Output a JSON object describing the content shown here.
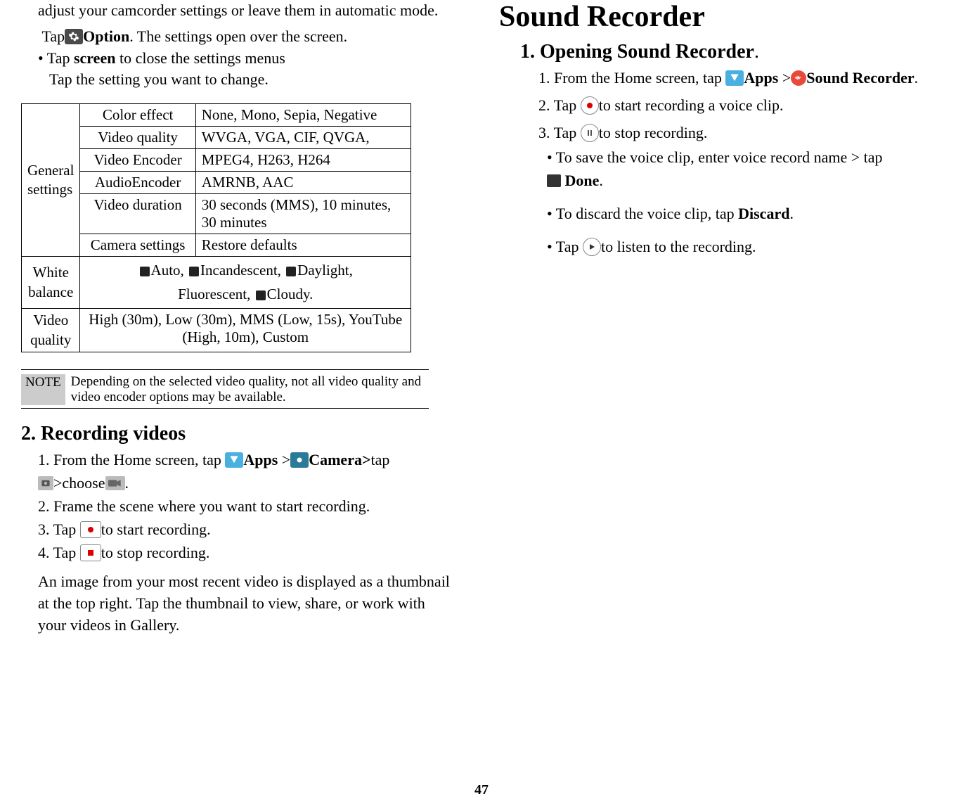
{
  "left": {
    "intro1": "adjust your camcorder settings or leave them in automatic mode.",
    "tap_label": "Tap",
    "option_bold": "Option",
    "tap_rest": ". The settings open over the screen.",
    "bullet1_a": "• Tap ",
    "bullet1_bold": "screen",
    "bullet1_b": " to close the settings menus",
    "bullet1_c": "Tap the setting you want to change.",
    "table": {
      "general_label": "General settings",
      "rows": [
        {
          "l": "Color effect",
          "r": "None, Mono, Sepia, Negative"
        },
        {
          "l": "Video quality",
          "r": " WVGA, VGA, CIF, QVGA,"
        },
        {
          "l": "Video Encoder",
          "r": " MPEG4, H263, H264"
        },
        {
          "l": "AudioEncoder",
          "r": " AMRNB, AAC"
        },
        {
          "l": "Video duration",
          "r": "30 seconds (MMS), 10 minutes, 30 minutes"
        },
        {
          "l": "Camera settings",
          "r": " Restore defaults"
        }
      ],
      "wb_label": "White balance",
      "wb_val_parts": [
        "Auto,  ",
        "Incandescent,  ",
        "Daylight,",
        "Fluorescent,  ",
        "Cloudy."
      ],
      "vq_label": "Video quality",
      "vq_val": "High (30m), Low (30m), MMS (Low, 15s), YouTube (High, 10m), Custom"
    },
    "note_label": "NOTE",
    "note_text": "Depending on the selected video quality, not all video quality and video encoder options may be available.",
    "h2": "2. Recording videos",
    "s1_a": "1. From the Home screen, tap  ",
    "s1_apps": "Apps",
    "s1_gt": " >",
    "s1_cam": "Camera>",
    "s1_tap": "tap",
    "s1_choose": ">choose",
    "s1_dot": ".",
    "s2": "2. Frame the scene where you want to start recording.",
    "s3a": "3. Tap  ",
    "s3b": "to start recording.",
    "s4a": "4. Tap  ",
    "s4b": "to stop recording.",
    "endtext": "An image from your most recent video is displayed as a thumbnail at the top right. Tap the thumbnail to view, share, or work with your videos in Gallery."
  },
  "right": {
    "h1": "Sound Recorder",
    "h2": "1. Opening Sound Recorder",
    "s1a": "1. From the Home screen, tap  ",
    "s1_apps": "Apps",
    "s1_gt": " >",
    "s1_bold": "Sound Recorder",
    "s1_dot": ".",
    "s2a": "2. Tap  ",
    "s2b": "to start recording a voice clip.",
    "s3a": "3. Tap  ",
    "s3b": "to stop recording.",
    "b1a": "• To save the voice clip, enter voice record name > tap ",
    "b1_done": "Done",
    "b1_dot": ".",
    "b2a": "• To discard the voice clip, tap ",
    "b2_bold": "Discard",
    "b2_dot": ".",
    "b3a": "• Tap  ",
    "b3b": "to listen to the recording."
  },
  "page_number": "47",
  "sep": "."
}
